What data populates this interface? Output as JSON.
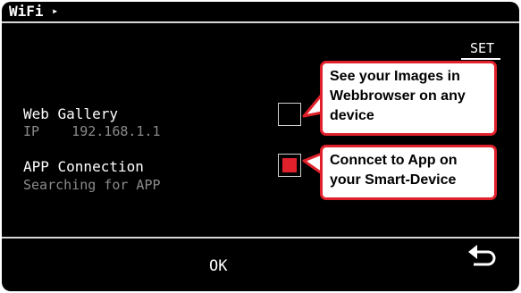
{
  "header": {
    "title": "WiFi",
    "arrow_icon": "triangle-right-icon"
  },
  "set_label": "SET",
  "rows": [
    {
      "title": "Web Gallery",
      "subtitle": "IP    192.168.1.1",
      "checked": false
    },
    {
      "title": "APP Connection",
      "subtitle": "Searching for APP",
      "checked": true
    }
  ],
  "callouts": [
    {
      "text": "See your Images in Webbrowser on any device"
    },
    {
      "text": "Conncet to App on your Smart-Device"
    }
  ],
  "footer": {
    "ok_label": "OK",
    "back_icon": "return-arrow-icon"
  },
  "colors": {
    "accent": "#e0202b",
    "background": "#000000",
    "text": "#ffffff",
    "muted": "#8a8a8a"
  }
}
